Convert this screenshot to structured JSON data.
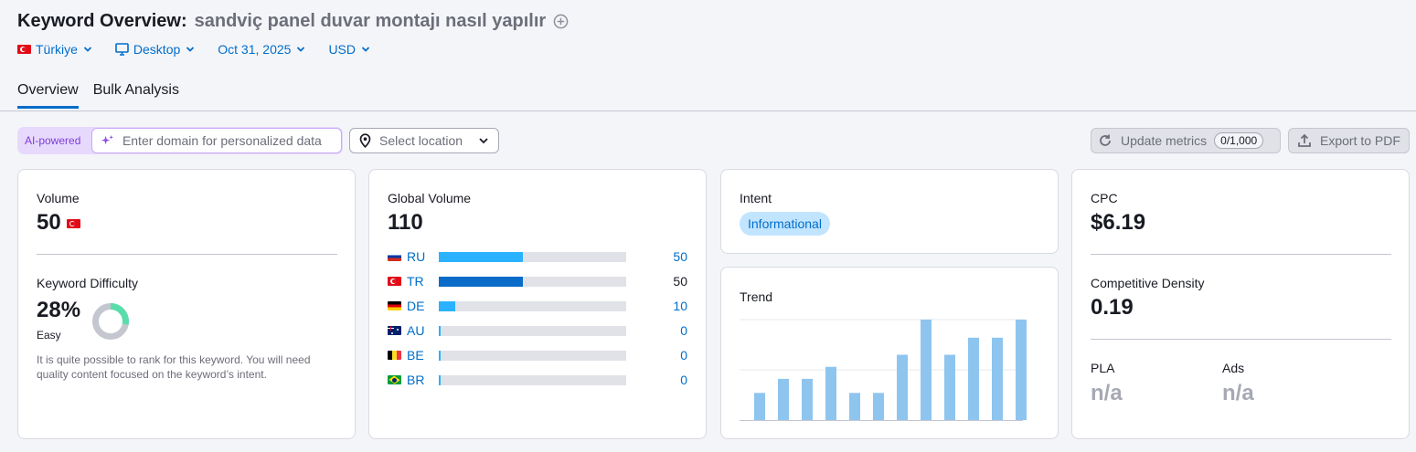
{
  "header": {
    "title": "Keyword Overview:",
    "keyword": "sandviç panel duvar montajı nasıl yapılır"
  },
  "filters": {
    "country": "Türkiye",
    "device": "Desktop",
    "date": "Oct 31, 2025",
    "currency": "USD"
  },
  "tabs": [
    "Overview",
    "Bulk Analysis"
  ],
  "toolbar": {
    "ai_label": "AI-powered",
    "domain_placeholder": "Enter domain for personalized data",
    "location_placeholder": "Select location",
    "update_label": "Update metrics",
    "update_counter": "0/1,000",
    "export_label": "Export to PDF"
  },
  "volume_card": {
    "volume_label": "Volume",
    "volume_value": "50",
    "kd_label": "Keyword Difficulty",
    "kd_value": "28%",
    "kd_level": "Easy",
    "kd_percent": 28,
    "kd_description": "It is quite possible to rank for this keyword. You will need quality content focused on the keyword’s intent."
  },
  "global_card": {
    "label": "Global Volume",
    "value": "110",
    "countries": [
      {
        "code": "RU",
        "value": "50",
        "fraction": 0.45,
        "color": "#2bb2ff",
        "highlight": false
      },
      {
        "code": "TR",
        "value": "50",
        "fraction": 0.45,
        "color": "#0a6bc8",
        "highlight": true
      },
      {
        "code": "DE",
        "value": "10",
        "fraction": 0.09,
        "color": "#2bb2ff",
        "highlight": false
      },
      {
        "code": "AU",
        "value": "0",
        "fraction": 0.012,
        "color": "#2bb2ff",
        "highlight": false
      },
      {
        "code": "BE",
        "value": "0",
        "fraction": 0.012,
        "color": "#2bb2ff",
        "highlight": false
      },
      {
        "code": "BR",
        "value": "0",
        "fraction": 0.012,
        "color": "#2bb2ff",
        "highlight": false
      }
    ]
  },
  "intent_card": {
    "label": "Intent",
    "badge": "Informational"
  },
  "trend_card": {
    "label": "Trend"
  },
  "chart_data": {
    "type": "bar",
    "title": "Trend",
    "categories": [],
    "values": [
      0.27,
      0.41,
      0.41,
      0.53,
      0.27,
      0.27,
      0.65,
      1.0,
      0.65,
      0.82,
      0.82,
      1.0
    ],
    "ylim": [
      0,
      1
    ],
    "grid": true,
    "color": "#8ec5ef"
  },
  "cpc_card": {
    "cpc_label": "CPC",
    "cpc_value": "$6.19",
    "cd_label": "Competitive Density",
    "cd_value": "0.19",
    "pla_label": "PLA",
    "pla_value": "n/a",
    "ads_label": "Ads",
    "ads_value": "n/a"
  }
}
